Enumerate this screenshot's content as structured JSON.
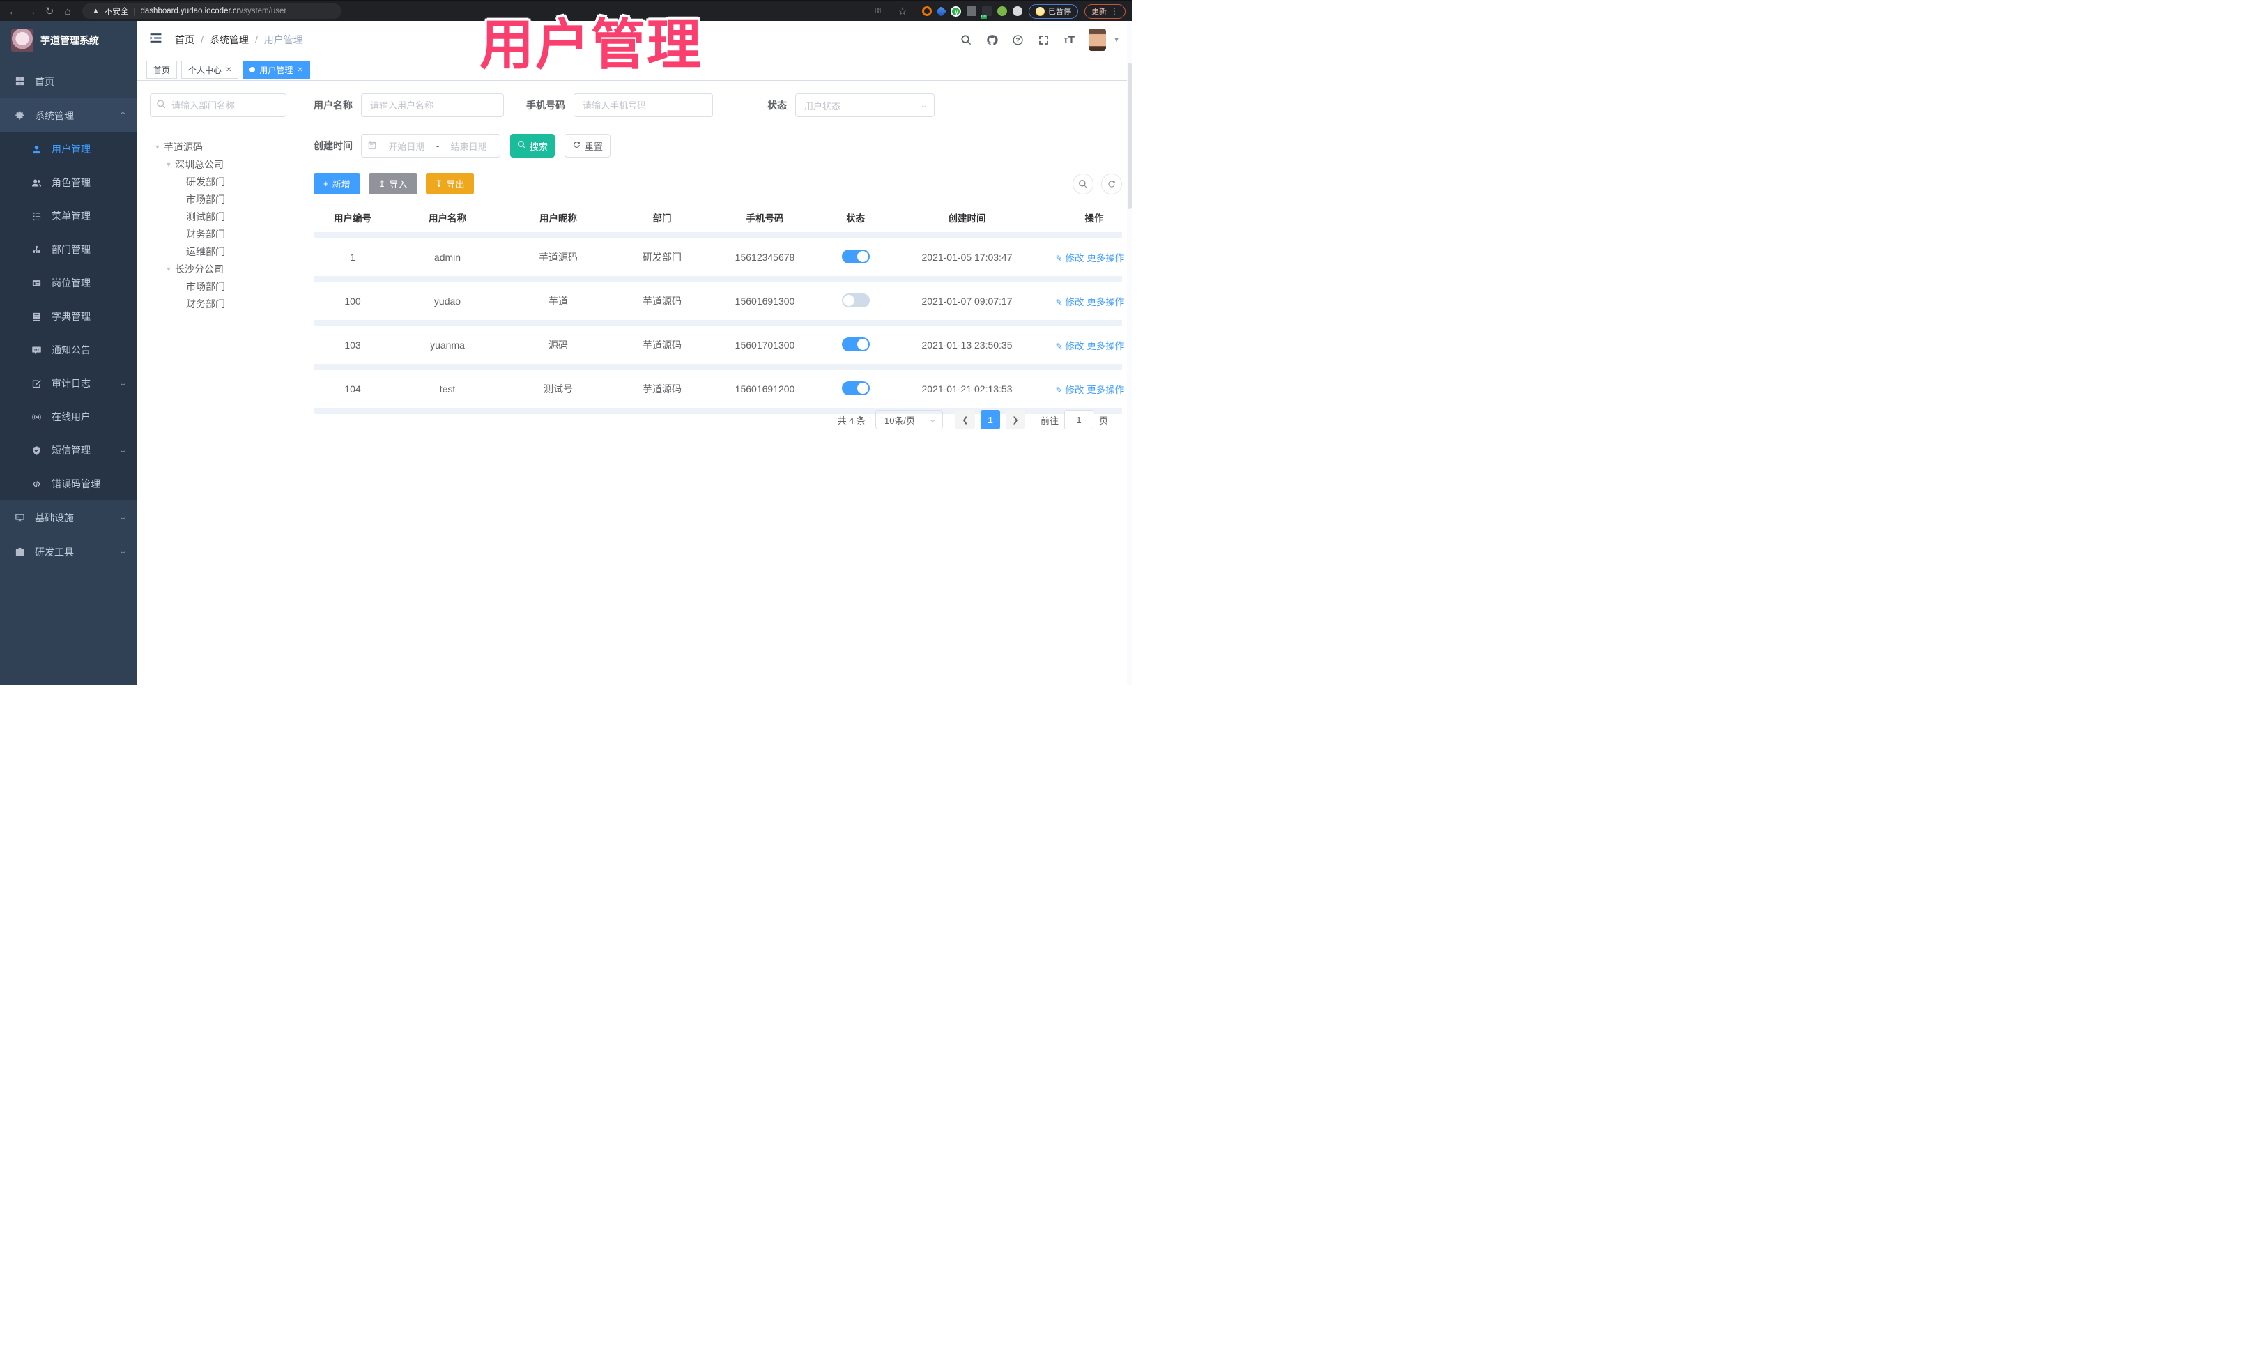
{
  "overlay": {
    "title": "用户管理",
    "color": "#fa3f6e"
  },
  "browser": {
    "security_label": "不安全",
    "url_host": "dashboard.yudao.iocoder.cn",
    "url_path": "/system/user",
    "paused_badge": "已暂停",
    "update_button": "更新",
    "extensions": [
      "orange-ring-extension",
      "blue-gem-extension",
      "green-y-extension",
      "grid-extension",
      "list-on-extension",
      "green-leaf-extension",
      "puzzle-extension"
    ]
  },
  "header": {
    "breadcrumb": [
      "首页",
      "系统管理",
      "用户管理"
    ],
    "icons": [
      "search-icon",
      "github-icon",
      "help-icon",
      "fullscreen-icon",
      "fontsize-icon"
    ]
  },
  "sidebar": {
    "app_title": "芋道管理系统",
    "items": [
      {
        "label": "首页",
        "icon": "dashboard",
        "type": "top"
      },
      {
        "label": "系统管理",
        "icon": "gear",
        "type": "top",
        "open": true,
        "arrow": "up"
      },
      {
        "label": "用户管理",
        "icon": "user",
        "type": "sub",
        "active": true
      },
      {
        "label": "角色管理",
        "icon": "users",
        "type": "sub"
      },
      {
        "label": "菜单管理",
        "icon": "menulist",
        "type": "sub"
      },
      {
        "label": "部门管理",
        "icon": "orgtree",
        "type": "sub"
      },
      {
        "label": "岗位管理",
        "icon": "badge",
        "type": "sub"
      },
      {
        "label": "字典管理",
        "icon": "book",
        "type": "sub"
      },
      {
        "label": "通知公告",
        "icon": "megaphone",
        "type": "sub"
      },
      {
        "label": "审计日志",
        "icon": "editlog",
        "type": "sub",
        "arrow": "down"
      },
      {
        "label": "在线用户",
        "icon": "online",
        "type": "sub"
      },
      {
        "label": "短信管理",
        "icon": "shieldcheck",
        "type": "sub",
        "arrow": "down"
      },
      {
        "label": "错误码管理",
        "icon": "code",
        "type": "sub"
      },
      {
        "label": "基础设施",
        "icon": "monitor",
        "type": "top",
        "arrow": "down"
      },
      {
        "label": "研发工具",
        "icon": "toolbox",
        "type": "top",
        "arrow": "down"
      }
    ]
  },
  "tabs": [
    {
      "label": "首页",
      "closable": false,
      "active": false
    },
    {
      "label": "个人中心",
      "closable": true,
      "active": false
    },
    {
      "label": "用户管理",
      "closable": true,
      "active": true
    }
  ],
  "tree": {
    "search_placeholder": "请输入部门名称",
    "nodes": [
      {
        "label": "芋道源码",
        "level": 0,
        "expanded": true
      },
      {
        "label": "深圳总公司",
        "level": 1,
        "expanded": true
      },
      {
        "label": "研发部门",
        "level": 2
      },
      {
        "label": "市场部门",
        "level": 2
      },
      {
        "label": "测试部门",
        "level": 2
      },
      {
        "label": "财务部门",
        "level": 2
      },
      {
        "label": "运维部门",
        "level": 2
      },
      {
        "label": "长沙分公司",
        "level": 1,
        "expanded": true
      },
      {
        "label": "市场部门",
        "level": 2
      },
      {
        "label": "财务部门",
        "level": 2
      }
    ]
  },
  "filters": {
    "username_label": "用户名称",
    "username_placeholder": "请输入用户名称",
    "mobile_label": "手机号码",
    "mobile_placeholder": "请输入手机号码",
    "status_label": "状态",
    "status_placeholder": "用户状态",
    "create_time_label": "创建时间",
    "date_start_placeholder": "开始日期",
    "date_separator": "-",
    "date_end_placeholder": "结束日期",
    "search_button": "搜索",
    "reset_button": "重置"
  },
  "toolbar": {
    "add_label": "新增",
    "import_label": "导入",
    "export_label": "导出"
  },
  "table": {
    "columns": [
      "用户编号",
      "用户名称",
      "用户昵称",
      "部门",
      "手机号码",
      "状态",
      "创建时间",
      "操作"
    ],
    "actions": {
      "edit": "修改",
      "more": "更多操作"
    },
    "rows": [
      {
        "id": "1",
        "username": "admin",
        "nickname": "芋道源码",
        "dept": "研发部门",
        "mobile": "15612345678",
        "status": true,
        "created": "2021-01-05 17:03:47"
      },
      {
        "id": "100",
        "username": "yudao",
        "nickname": "芋道",
        "dept": "芋道源码",
        "mobile": "15601691300",
        "status": false,
        "created": "2021-01-07 09:07:17"
      },
      {
        "id": "103",
        "username": "yuanma",
        "nickname": "源码",
        "dept": "芋道源码",
        "mobile": "15601701300",
        "status": true,
        "created": "2021-01-13 23:50:35"
      },
      {
        "id": "104",
        "username": "test",
        "nickname": "测试号",
        "dept": "芋道源码",
        "mobile": "15601691200",
        "status": true,
        "created": "2021-01-21 02:13:53"
      }
    ]
  },
  "pagination": {
    "total_text": "共 4 条",
    "page_size": "10条/页",
    "current_page": "1",
    "goto_label": "前往",
    "goto_value": "1",
    "page_unit": "页"
  }
}
